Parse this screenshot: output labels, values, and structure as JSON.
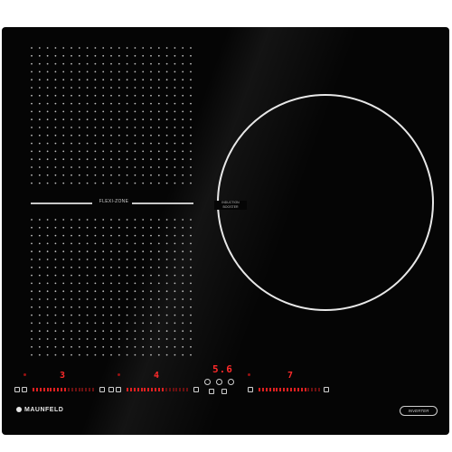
{
  "hob": {
    "flexi_zone_label": "FLEXI-ZONE",
    "induction_label_line1": "INDUCTION",
    "induction_label_line2": "BOOSTER"
  },
  "zones": [
    {
      "name": "zone-1",
      "level": "3",
      "slider_fill": 0.55
    },
    {
      "name": "zone-2",
      "level": "4",
      "slider_fill": 0.6
    },
    {
      "name": "timer",
      "level": "5.6"
    },
    {
      "name": "zone-4",
      "level": "7",
      "slider_fill": 0.75
    }
  ],
  "brand": {
    "name": "MAUNFELD"
  },
  "badge": {
    "text": "INVERTER"
  },
  "colors": {
    "glass": "#050505",
    "display": "#ff2a2a",
    "print": "#e8e8e8"
  },
  "icons": [
    "lock-icon",
    "power-icon",
    "plus-icon",
    "minus-icon"
  ]
}
